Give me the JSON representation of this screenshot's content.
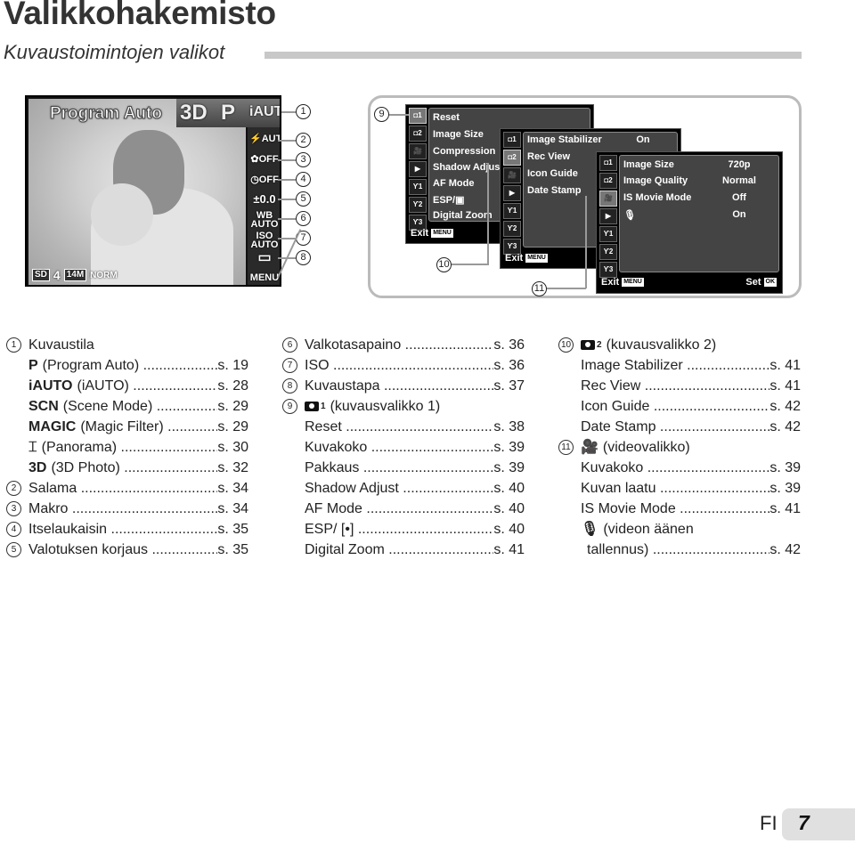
{
  "header": {
    "title": "Valikkohakemisto",
    "subtitle": "Kuvaustoimintojen valikot"
  },
  "camera_screen": {
    "mode_title": "Program Auto",
    "mode_icons": [
      "3D",
      "P",
      "iAUTO"
    ],
    "side_icons": [
      {
        "name": "flash-auto",
        "text": "⚡AUTO"
      },
      {
        "name": "macro-off",
        "text": "✿OFF"
      },
      {
        "name": "self-timer-off",
        "text": "◷OFF"
      },
      {
        "name": "exposure-comp",
        "text": "±0.0"
      },
      {
        "name": "white-balance",
        "text": "WB AUTO"
      },
      {
        "name": "iso",
        "text": "ISO AUTO"
      },
      {
        "name": "drive",
        "text": "▭"
      },
      {
        "name": "menu",
        "text": "MENU"
      }
    ],
    "bottom_info": {
      "card": "SD",
      "shots": "4",
      "size": "14M",
      "quality": "NORM"
    },
    "callouts": [
      "1",
      "2",
      "3",
      "4",
      "5",
      "6",
      "7",
      "8"
    ]
  },
  "menus": {
    "callouts": [
      "9",
      "10",
      "11"
    ],
    "tab_labels": [
      "◘1",
      "◘2",
      "🎥",
      "▶",
      "ϒ1",
      "ϒ2",
      "ϒ3"
    ],
    "menu1": {
      "items": [
        "Reset",
        "Image Size",
        "Compression",
        "Shadow Adjust",
        "AF Mode",
        "ESP/▣",
        "Digital Zoom"
      ],
      "exit": "Exit",
      "exit_key": "MENU"
    },
    "menu2": {
      "items": [
        "Image Stabilizer",
        "Rec View",
        "Icon Guide",
        "Date Stamp"
      ],
      "values": [
        "On",
        "",
        "",
        ""
      ],
      "exit": "Exit",
      "exit_key": "MENU"
    },
    "menu3": {
      "items": [
        "Image Size",
        "Image Quality",
        "IS Movie Mode",
        "🎙"
      ],
      "values": [
        "720p",
        "Normal",
        "Off",
        "On"
      ],
      "exit": "Exit",
      "exit_key": "MENU",
      "set": "Set",
      "set_key": "OK"
    }
  },
  "index": {
    "col1": [
      {
        "num": "1",
        "label": "Kuvaustila"
      },
      {
        "sym": "P",
        "label": "(Program Auto)",
        "page": "s. 19"
      },
      {
        "sym": "iAUTO",
        "label": "(iAUTO)",
        "page": "s. 28"
      },
      {
        "sym": "SCN",
        "label": "(Scene Mode)",
        "page": "s. 29"
      },
      {
        "sym": "MAGIC",
        "label": "(Magic Filter)",
        "page": "s. 29"
      },
      {
        "sym": "⌶",
        "label": "(Panorama)",
        "page": "s. 30"
      },
      {
        "sym": "3D",
        "label": "(3D Photo)",
        "page": "s. 32"
      },
      {
        "num": "2",
        "label": "Salama",
        "page": "s. 34"
      },
      {
        "num": "3",
        "label": "Makro",
        "page": "s. 34"
      },
      {
        "num": "4",
        "label": "Itselaukaisin",
        "page": "s. 35"
      },
      {
        "num": "5",
        "label": "Valotuksen korjaus",
        "page": "s. 35"
      }
    ],
    "col2": [
      {
        "num": "6",
        "label": "Valkotasapaino",
        "page": "s. 36"
      },
      {
        "num": "7",
        "label": "ISO",
        "page": "s. 36"
      },
      {
        "num": "8",
        "label": "Kuvaustapa",
        "page": "s. 37"
      },
      {
        "num": "9",
        "sub": "1",
        "label": "(kuvausvalikko 1)"
      },
      {
        "label": "Reset",
        "page": "s. 38"
      },
      {
        "label": "Kuvakoko",
        "page": "s. 39"
      },
      {
        "label": "Pakkaus",
        "page": "s. 39"
      },
      {
        "label": "Shadow Adjust",
        "page": "s. 40"
      },
      {
        "label": "AF Mode",
        "page": "s. 40"
      },
      {
        "label": "ESP/ [•]",
        "page": "s. 40"
      },
      {
        "label": "Digital Zoom",
        "page": "s. 41"
      }
    ],
    "col3": [
      {
        "num": "10",
        "sub": "2",
        "label": "(kuvausvalikko 2)"
      },
      {
        "label": "Image Stabilizer",
        "page": "s. 41"
      },
      {
        "label": "Rec View",
        "page": "s. 41"
      },
      {
        "label": "Icon Guide",
        "page": "s. 42"
      },
      {
        "label": "Date Stamp",
        "page": "s. 42"
      },
      {
        "num": "11",
        "sym": "🎥",
        "label": "(videovalikko)"
      },
      {
        "label": "Kuvakoko",
        "page": "s. 39"
      },
      {
        "label": "Kuvan laatu",
        "page": "s. 39"
      },
      {
        "label": "IS Movie Mode",
        "page": "s. 41"
      },
      {
        "sym": "🎙",
        "label": "(videon äänen"
      },
      {
        "label": "tallennus)",
        "page": "s. 42",
        "extra_indent": true
      }
    ]
  },
  "footer": {
    "lang": "FI",
    "page": "7"
  }
}
